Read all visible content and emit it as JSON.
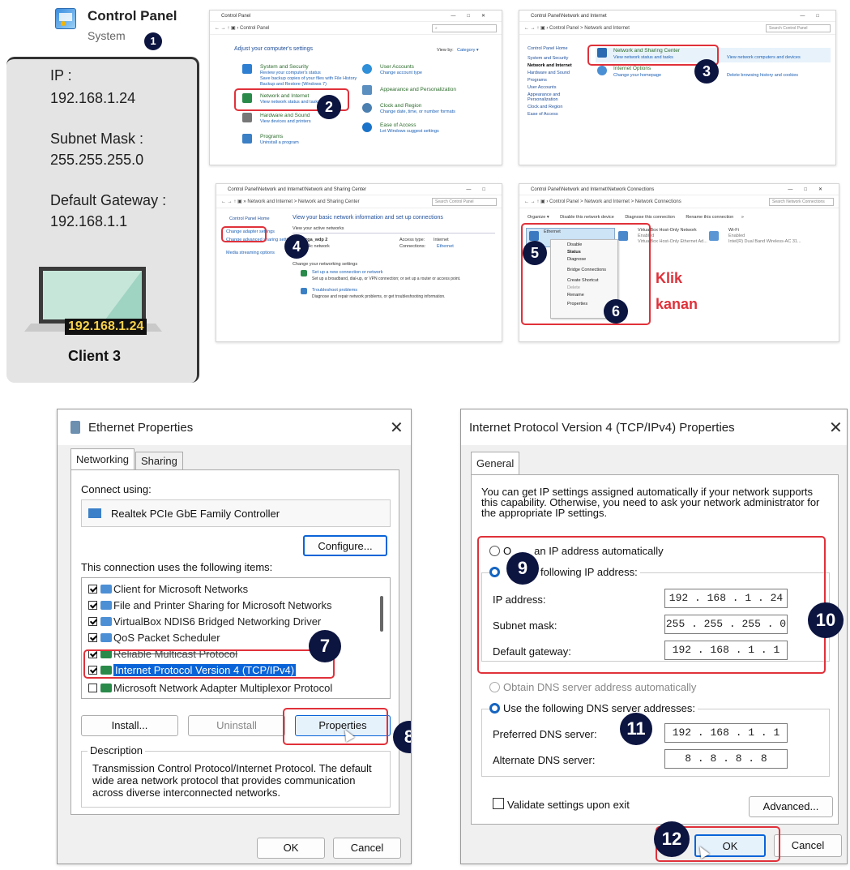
{
  "step1": {
    "title": "Control Panel",
    "subtitle": "System",
    "badge": "1"
  },
  "client": {
    "ip_label": "IP :",
    "ip_value": "192.168.1.24",
    "mask_label": "Subnet Mask :",
    "mask_value": "255.255.255.0",
    "gw_label": "Default Gateway :",
    "gw_value": "192.168.1.1",
    "laptop_ip": "192.168.1.24",
    "name": "Client 3"
  },
  "cp": {
    "title": "Control Panel",
    "address": "Control Panel",
    "heading": "Adjust your computer's settings",
    "view_by": "View by:",
    "view_value": "Category ▾",
    "cats_left": [
      {
        "title": "System and Security",
        "links": "Review your computer's status"
      },
      {
        "title": "Network and Internet",
        "links": "View network status and tasks"
      },
      {
        "title": "Hardware and Sound",
        "links": "View devices and printers"
      },
      {
        "title": "Programs",
        "links": "Uninstall a program"
      }
    ],
    "cats_right": [
      {
        "title": "User Accounts",
        "links": "Change account type"
      },
      {
        "title": "Appearance and Personalization",
        "links": ""
      },
      {
        "title": "Clock and Region",
        "links": "Change date, time, or number formats"
      },
      {
        "title": "Ease of Access",
        "links": "Let Windows suggest settings"
      }
    ],
    "badge": "2"
  },
  "ni": {
    "title": "Control Panel\\Network and Internet",
    "address": "Control Panel  >  Network and Internet",
    "search": "Search Control Panel",
    "sidebar": [
      "Control Panel Home",
      "System and Security",
      "Network and Internet",
      "Hardware and Sound",
      "Programs",
      "User Accounts",
      "Appearance and Personalization",
      "Clock and Region",
      "Ease of Access"
    ],
    "nsc_title": "Network and Sharing Center",
    "nsc_links": "View network status and tasks",
    "inet_title": "Internet Options",
    "inet_links": "Change your homepage",
    "extra1": "View network computers and devices",
    "extra2": "Delete browsing history and cookies",
    "badge": "3"
  },
  "nsc": {
    "title": "Control Panel\\Network and Internet\\Network and Sharing Center",
    "address": "Network and Internet  >  Network and Sharing Center",
    "search": "Search Control Panel",
    "side_home": "Control Panel Home",
    "side_adapter": "Change adapter settings",
    "side_advanced": "Change advanced sharing settings",
    "side_media": "Media streaming options",
    "heading": "View your basic network information and set up connections",
    "active": "View your active networks",
    "net_name": "varga_wdp 2",
    "net_type": "Public network",
    "access_label": "Access type:",
    "access_value": "Internet",
    "conn_label": "Connections:",
    "conn_value": "Ethernet",
    "change": "Change your networking settings",
    "setup": "Set up a new connection or network",
    "troubleshoot": "Troubleshoot problems",
    "badge": "4"
  },
  "nc": {
    "title": "Control Panel\\Network and Internet\\Network Connections",
    "address": "Control Panel  >  Network and Internet  >  Network Connections",
    "search": "Search Network Connections",
    "toolbar": [
      "Organize ▾",
      "Disable this network device",
      "Diagnose this connection",
      "Rename this connection",
      "»"
    ],
    "eth": "Ethernet",
    "vbox_title": "VirtualBox Host-Only Network",
    "vbox_status": "Enabled",
    "vbox_dev": "VirtualBox Host-Only Ethernet Ad...",
    "wifi_title": "Wi-Fi",
    "wifi_status": "Enabled",
    "wifi_dev": "Intel(R) Dual Band Wireless-AC 31...",
    "menu": [
      "Disable",
      "Status",
      "Diagnose",
      "Bridge Connections",
      "Create Shortcut",
      "Delete",
      "Rename",
      "Properties"
    ],
    "klik": "Klik",
    "kanan": "kanan",
    "badge5": "5",
    "badge6": "6"
  },
  "eth": {
    "title": "Ethernet Properties",
    "tabs": [
      "Networking",
      "Sharing"
    ],
    "connect_using": "Connect using:",
    "adapter": "Realtek PCIe GbE Family Controller",
    "configure": "Configure...",
    "items_label": "This connection uses the following items:",
    "items": [
      {
        "label": "Client for Microsoft Networks",
        "checked": true
      },
      {
        "label": "File and Printer Sharing for Microsoft Networks",
        "checked": true
      },
      {
        "label": "VirtualBox NDIS6 Bridged Networking Driver",
        "checked": true
      },
      {
        "label": "QoS Packet Scheduler",
        "checked": true
      },
      {
        "label": "Reliable Multicast Protocol",
        "checked": true
      },
      {
        "label": "Internet Protocol Version 4 (TCP/IPv4)",
        "checked": true
      },
      {
        "label": "Microsoft Network Adapter Multiplexor Protocol",
        "checked": false
      }
    ],
    "install": "Install...",
    "uninstall": "Uninstall",
    "properties": "Properties",
    "desc_label": "Description",
    "desc": "Transmission Control Protocol/Internet Protocol. The default wide area network protocol that provides communication across diverse interconnected networks.",
    "ok": "OK",
    "cancel": "Cancel",
    "badge7": "7",
    "badge8": "8"
  },
  "ipv4": {
    "title": "Internet Protocol Version 4 (TCP/IPv4) Properties",
    "tab": "General",
    "intro": "You can get IP settings assigned automatically if your network supports this capability. Otherwise, you need to ask your network administrator for the appropriate IP settings.",
    "auto_ip": "an IP address automatically",
    "auto_ip_prefix": "O",
    "use_ip": "following IP address:",
    "ip_label": "IP address:",
    "ip_value": "192 . 168 .  1  . 24",
    "mask_label": "Subnet mask:",
    "mask_value": "255 . 255 . 255 .  0",
    "gw_label": "Default gateway:",
    "gw_value": "192 . 168 .  1  .  1",
    "auto_dns": "Obtain DNS server address automatically",
    "use_dns": "Use the following DNS server addresses:",
    "pdns_label": "Preferred DNS server:",
    "pdns_value": "192 . 168 .  1  .  1",
    "adns_label": "Alternate DNS server:",
    "adns_value": " 8  .  8  .  8  .  8",
    "validate": "Validate settings upon exit",
    "advanced": "Advanced...",
    "ok": "OK",
    "cancel": "Cancel",
    "badge9": "9",
    "badge10": "10",
    "badge11": "11",
    "badge12": "12"
  },
  "colors": {
    "badge": "#0c1440",
    "highlight": "#e0313a",
    "selection": "#0a64d8",
    "link": "#1a5fb4"
  }
}
